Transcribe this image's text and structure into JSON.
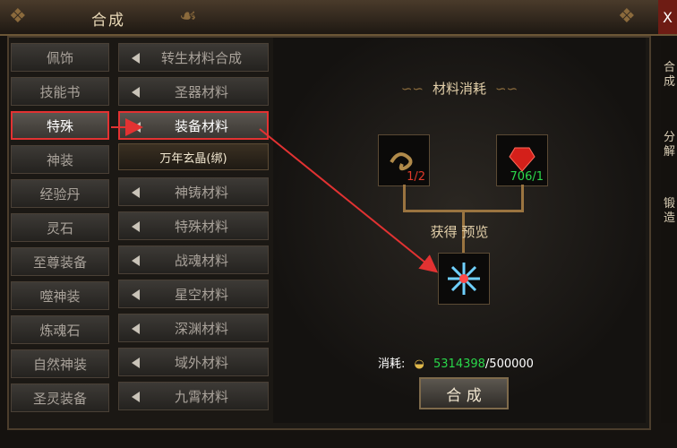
{
  "window": {
    "title": "合成",
    "close": "X"
  },
  "left_menu": [
    "佩饰",
    "技能书",
    "特殊",
    "神装",
    "经验丹",
    "灵石",
    "至尊装备",
    "噬神装",
    "炼魂石",
    "自然神装",
    "圣灵装备"
  ],
  "right_menu": [
    "转生材料合成",
    "圣器材料",
    "装备材料",
    "神铸材料",
    "特殊材料",
    "战魂材料",
    "星空材料",
    "深渊材料",
    "域外材料",
    "九霄材料"
  ],
  "selected_sub": "万年玄晶(绑)",
  "materials_heading": "材料消耗",
  "material_1_qty": "1/2",
  "material_2_qty": "706/1",
  "preview_heading": "获得 预览",
  "cost": {
    "label": "消耗:",
    "have": "5314398",
    "need": "/500000"
  },
  "synth_button": "合 成",
  "side_tabs": {
    "t1a": "合",
    "t1b": "成",
    "t2a": "分",
    "t2b": "解",
    "t3a": "锻",
    "t3b": "造"
  }
}
